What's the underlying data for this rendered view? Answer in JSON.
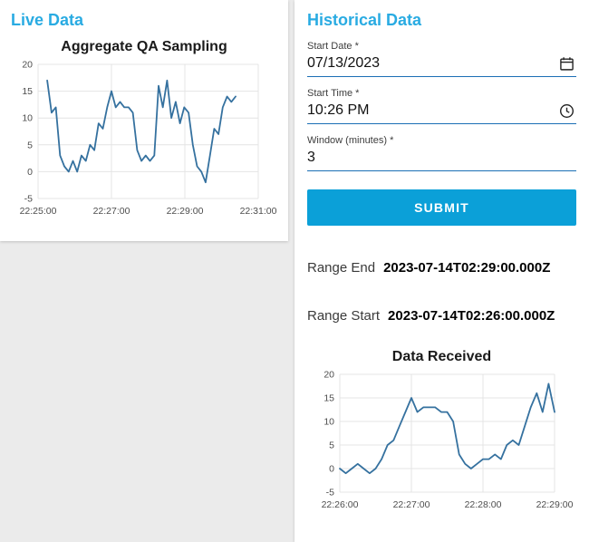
{
  "accent_color": "#29abe2",
  "button_color": "#0ba0d8",
  "line_color": "#35719f",
  "live_panel": {
    "title": "Live Data"
  },
  "historical_panel": {
    "title": "Historical Data",
    "fields": [
      {
        "label": "Start Date *",
        "value": "07/13/2023",
        "icon": "calendar-icon"
      },
      {
        "label": "Start Time *",
        "value": "10:26 PM",
        "icon": "clock-icon"
      },
      {
        "label": "Window (minutes) *",
        "value": "3",
        "icon": ""
      }
    ],
    "submit_label": "SUBMIT",
    "range_end_label": "Range End",
    "range_end_value": "2023-07-14T02:29:00.000Z",
    "range_start_label": "Range Start",
    "range_start_value": "2023-07-14T02:26:00.000Z"
  },
  "chart_data": [
    {
      "type": "line",
      "title": "Aggregate QA Sampling",
      "xlabel": "",
      "ylabel": "",
      "ylim": [
        -5,
        20
      ],
      "y_ticks": [
        -5,
        0,
        5,
        10,
        15,
        20
      ],
      "x_range": [
        0,
        360
      ],
      "x_ticks": [
        "22:25:00",
        "22:27:00",
        "22:29:00",
        "22:31:00"
      ],
      "x_tick_pos": [
        0,
        120,
        240,
        360
      ],
      "line_color": "#35719f",
      "grid": true,
      "legend": "none",
      "x": [
        15,
        22,
        29,
        36,
        43,
        50,
        57,
        64,
        71,
        78,
        85,
        92,
        99,
        106,
        113,
        120,
        127,
        134,
        141,
        148,
        155,
        162,
        169,
        176,
        183,
        190,
        197,
        204,
        211,
        218,
        225,
        232,
        239,
        246,
        253,
        260,
        267,
        274,
        281,
        288,
        295,
        302,
        309,
        316,
        323
      ],
      "values": [
        17,
        11,
        12,
        3,
        1,
        0,
        2,
        0,
        3,
        2,
        5,
        4,
        9,
        8,
        12,
        15,
        12,
        13,
        12,
        12,
        11,
        4,
        2,
        3,
        2,
        3,
        16,
        12,
        17,
        10,
        13,
        9,
        12,
        11,
        5,
        1,
        0,
        -2,
        3,
        8,
        7,
        12,
        14,
        13,
        14
      ]
    },
    {
      "type": "line",
      "title": "Data Received",
      "xlabel": "",
      "ylabel": "",
      "ylim": [
        -5,
        20
      ],
      "y_ticks": [
        -5,
        0,
        5,
        10,
        15,
        20
      ],
      "x_range": [
        0,
        180
      ],
      "x_ticks": [
        "22:26:00",
        "22:27:00",
        "22:28:00",
        "22:29:00"
      ],
      "x_tick_pos": [
        0,
        60,
        120,
        180
      ],
      "line_color": "#35719f",
      "grid": true,
      "legend": "none",
      "x": [
        0,
        5,
        10,
        15,
        20,
        25,
        30,
        35,
        40,
        45,
        50,
        55,
        60,
        65,
        70,
        75,
        80,
        85,
        90,
        95,
        100,
        105,
        110,
        115,
        120,
        125,
        130,
        135,
        140,
        145,
        150,
        155,
        160,
        165,
        170,
        175,
        180
      ],
      "values": [
        0,
        -1,
        0,
        1,
        0,
        -1,
        0,
        2,
        5,
        6,
        9,
        12,
        15,
        12,
        13,
        13,
        13,
        12,
        12,
        10,
        3,
        1,
        0,
        1,
        2,
        2,
        3,
        2,
        5,
        6,
        5,
        9,
        13,
        16,
        12,
        18,
        12
      ]
    }
  ]
}
